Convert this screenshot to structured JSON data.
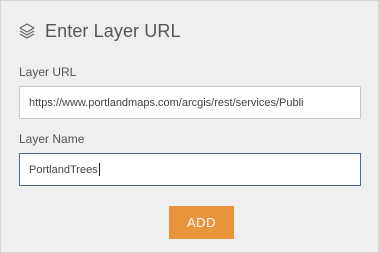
{
  "header": {
    "title": "Enter Layer URL",
    "icon": "layers-icon"
  },
  "layer_url": {
    "label": "Layer URL",
    "value": "https://www.portlandmaps.com/arcgis/rest/services/Publi"
  },
  "layer_name": {
    "label": "Layer Name",
    "value": "PortlandTrees"
  },
  "add_button": {
    "label": "ADD"
  },
  "colors": {
    "accent": "#e7943a",
    "active_border": "#4a6b8f",
    "panel_bg": "#efefef"
  }
}
